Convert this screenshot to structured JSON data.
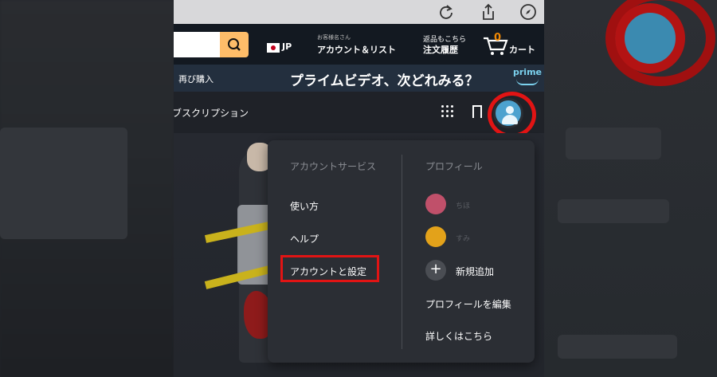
{
  "safari": {
    "icons": [
      "reload-icon",
      "share-icon",
      "compass-icon"
    ]
  },
  "amazon_nav": {
    "locale": "JP",
    "account_hint": "お客様名さん",
    "account": "アカウント＆リスト",
    "orders_hint": "返品もこちら",
    "orders": "注文履歴",
    "cart_count": "0",
    "cart": "カート"
  },
  "sub_nav": {
    "rebuy": "再び購入",
    "banner": "プライムビデオ、次どれみる？",
    "prime": "prime"
  },
  "pv_header": {
    "subscription": "ブスクリプション"
  },
  "dropdown": {
    "account_title": "アカウントサービス",
    "account_items": [
      "使い方",
      "ヘルプ",
      "アカウントと設定"
    ],
    "profile_title": "プロフィール",
    "profiles": [
      {
        "name": "ちほ",
        "color": "#c0506a"
      },
      {
        "name": "すみ",
        "color": "#e3a21a"
      }
    ],
    "add_label": "新規追加",
    "edit_label": "プロフィールを編集",
    "learn_label": "詳しくはこちら"
  },
  "colors": {
    "highlight": "#e11414",
    "avatar": "#4da2cf",
    "search_button": "#febd69"
  }
}
